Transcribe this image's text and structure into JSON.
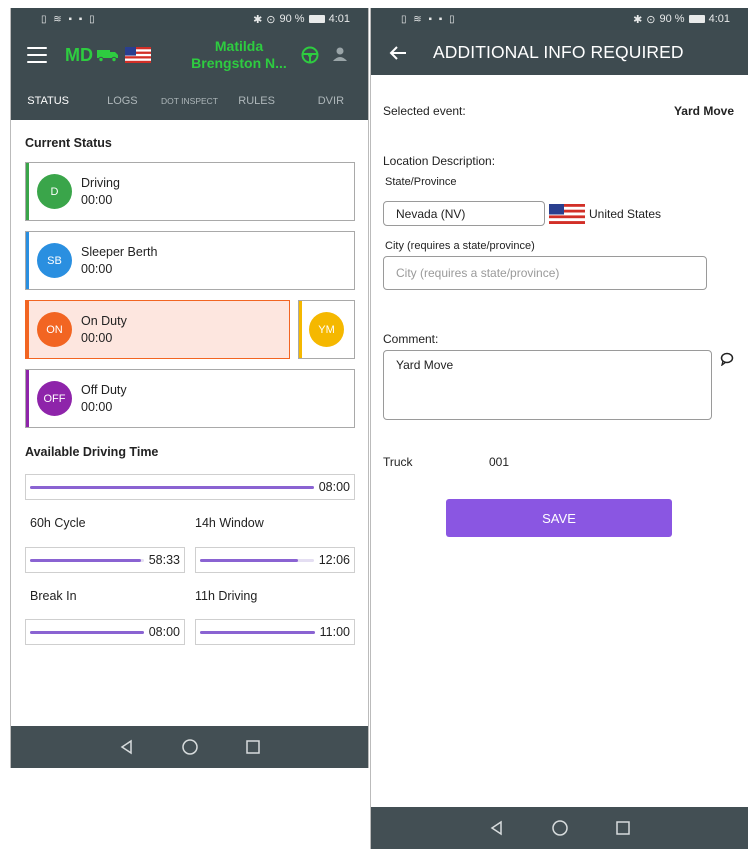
{
  "statusbar": {
    "icons_left": "▯ ≋ ▪ ▪ ▯",
    "battery": "90 %",
    "time": "4:01"
  },
  "left": {
    "brand": "MD",
    "user_name": "Matilda Brengston N...",
    "tabs": [
      {
        "label": "STATUS"
      },
      {
        "label": "LOGS"
      },
      {
        "label": "DOT INSPECT"
      },
      {
        "label": "RULES"
      },
      {
        "label": "DVIR"
      }
    ],
    "current_status_title": "Current Status",
    "statuses": [
      {
        "code": "D",
        "name": "Driving",
        "time": "00:00",
        "color": "#3aa54a"
      },
      {
        "code": "SB",
        "name": "Sleeper Berth",
        "time": "00:00",
        "color": "#2a8fe0"
      },
      {
        "code": "ON",
        "name": "On Duty",
        "time": "00:00",
        "color": "#f26522"
      },
      {
        "code": "OFF",
        "name": "Off Duty",
        "time": "00:00",
        "color": "#8e24aa"
      }
    ],
    "ym_code": "YM",
    "available_title": "Available Driving Time",
    "driving_total": {
      "value": "08:00",
      "fill": 1.0
    },
    "cycle": {
      "label": "60h Cycle",
      "value": "58:33",
      "fill": 0.98
    },
    "window": {
      "label": "14h Window",
      "value": "12:06",
      "fill": 0.86
    },
    "break": {
      "label": "Break In",
      "value": "08:00",
      "fill": 1.0
    },
    "driving11": {
      "label": "11h Driving",
      "value": "11:00",
      "fill": 1.0
    }
  },
  "right": {
    "title": "ADDITIONAL INFO REQUIRED",
    "selected_event_label": "Selected event:",
    "selected_event_value": "Yard Move",
    "location_label": "Location Description:",
    "state_label": "State/Province",
    "state_value": "Nevada (NV)",
    "country": "United States",
    "city_label": "City (requires a state/province)",
    "city_placeholder": "City (requires a state/province)",
    "comment_label": "Comment:",
    "comment_value": "Yard Move",
    "truck_label": "Truck",
    "truck_value": "001",
    "save_label": "SAVE"
  },
  "colors": {
    "appbar": "#3e4b50",
    "brand_green": "#2ecc40",
    "progress": "#8a63d2",
    "save": "#8a56e2"
  }
}
